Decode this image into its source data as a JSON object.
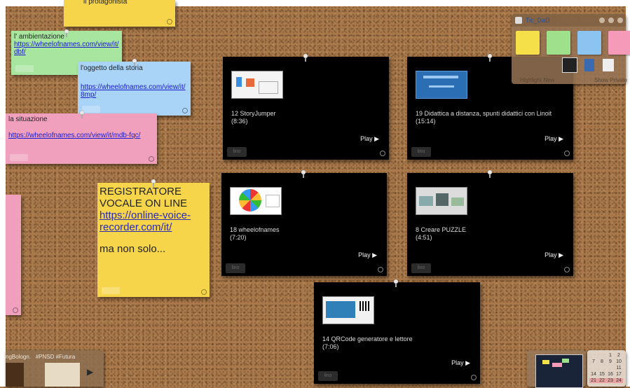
{
  "notes": {
    "protagonista": {
      "text": "il protagonista"
    },
    "ambientazione": {
      "label": "l' ambientazione",
      "link": "https://wheelofnames.com/view/it/dbf/"
    },
    "oggetto": {
      "label": "l'oggetto della storia",
      "link": "https://wheelofnames.com/view/it/8mp/"
    },
    "situazione": {
      "label": "la situazione",
      "link": "https://wheelofnames.com/view/it/mdb-fqc/"
    },
    "registratore": {
      "heading": "REGISTRATORE VOCALE ON LINE",
      "link": "https://online-voice-recorder.com/it/",
      "footer": "ma non solo..."
    }
  },
  "videos": [
    {
      "title": "12 StoryJumper",
      "duration": "(8:36)",
      "play": "Play ▶"
    },
    {
      "title": "19 Didattica a distanza, spunti didattici con Linoit",
      "duration": "(15:14)",
      "play": "Play ▶"
    },
    {
      "title": "18 wheelofnames",
      "duration": "(7:20)",
      "play": "Play ▶"
    },
    {
      "title": "8 Creare PUZZLE",
      "duration": "(4:51)",
      "play": "Play ▶"
    },
    {
      "title": "14 QRCode generatore e lettore",
      "duration": "(7:06)",
      "play": "Play ▶"
    }
  ],
  "toolbar": {
    "title": "Tic_DaD",
    "highlight": "Highlight New",
    "show_private": "Show Private",
    "note_colors": [
      "#f5e04a",
      "#9fe08a",
      "#8cc4f0",
      "#f59ab8"
    ]
  },
  "tags": {
    "text": "ngBologn.   #PNSD #Futura"
  },
  "calendar": {
    "rows": [
      [
        "",
        "",
        "1",
        "2"
      ],
      [
        "7",
        "8",
        "9",
        "10"
      ],
      [
        "",
        "",
        "",
        "11"
      ],
      [
        "14",
        "15",
        "16",
        "17"
      ],
      [
        "21",
        "22",
        "23",
        "24"
      ]
    ]
  },
  "colors": {
    "yellow": "#f7d54a",
    "green": "#a8e6a0",
    "blue": "#a9d3f7",
    "pink": "#f0a0bd",
    "cork": "#a9794b"
  }
}
